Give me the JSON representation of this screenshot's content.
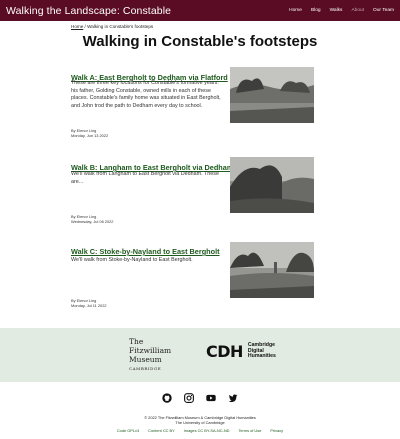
{
  "header": {
    "site_title": "Walking the Landscape: Constable",
    "nav": [
      {
        "label": "Home",
        "active": false
      },
      {
        "label": "Blog",
        "active": false
      },
      {
        "label": "Walks",
        "active": false
      },
      {
        "label": "About",
        "active": true
      },
      {
        "label": "Our Team",
        "active": false
      }
    ]
  },
  "breadcrumb": {
    "home": "Home",
    "separator": " / ",
    "current": "Walking in Constable's footsteps"
  },
  "page_title": "Walking in Constable's footsteps",
  "walks": [
    {
      "title": "Walk A: East Bergholt to Dedham via Flatford",
      "text": "These are three key locations for Constable's formative years: his father, Golding Constable, owned mills in each of these places. Constable's family home was situated in East Bergholt, and John trod the path to Dedham every day to school.",
      "author": "By Elenor Ling",
      "date": "Monday, Jun 13 2022"
    },
    {
      "title": "Walk B: Langham to East Bergholt via Dedham",
      "text": "We'll walk from Langham to East Bergholt via Dedham. These are...",
      "author": "By Elenor Ling",
      "date": "Wednesday, Jul 06 2022"
    },
    {
      "title": "Walk C: Stoke-by-Nayland to East Bergholt",
      "text": "We'll walk from Stoke-by-Nayland to East Bergholt.",
      "author": "By Elenor Ling",
      "date": "Monday, Jul 11 2022"
    }
  ],
  "partners": {
    "fitzwilliam": {
      "line1": "The",
      "line2": "Fitzwilliam",
      "line3": "Museum",
      "line4": "CAMBRIDGE"
    },
    "cdh": {
      "mark": "CDH",
      "line1": "Cambridge",
      "line2": "Digital",
      "line3": "Humanities"
    }
  },
  "social_icons": [
    "github-icon",
    "instagram-icon",
    "youtube-icon",
    "twitter-icon"
  ],
  "footer": {
    "copyright": "© 2022 The Fitzwilliam Museum & Cambridge Digital Humanities",
    "university": "The University of Cambridge",
    "links": [
      "Code GPLv3",
      "Content CC BY",
      "Images CC BY-SA-NC-ND",
      "Terms of Use",
      "Privacy"
    ]
  },
  "colors": {
    "header_bg": "#5a0c24",
    "link_green": "#1d5a1d",
    "partner_band": "#e2ebe1"
  }
}
